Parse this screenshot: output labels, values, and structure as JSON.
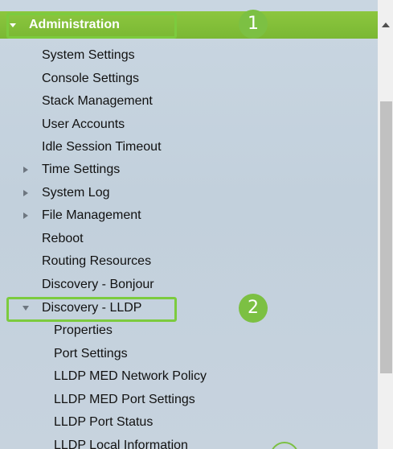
{
  "header": {
    "label": "Administration",
    "annotation_number": "1"
  },
  "menu": {
    "items": [
      {
        "label": "System Settings"
      },
      {
        "label": "Console Settings"
      },
      {
        "label": "Stack Management"
      },
      {
        "label": "User Accounts"
      },
      {
        "label": "Idle Session Timeout"
      },
      {
        "label": "Time Settings",
        "expandable": true,
        "expanded": false
      },
      {
        "label": "System Log",
        "expandable": true,
        "expanded": false
      },
      {
        "label": "File Management",
        "expandable": true,
        "expanded": false
      },
      {
        "label": "Reboot"
      },
      {
        "label": "Routing Resources"
      },
      {
        "label": "Discovery - Bonjour"
      },
      {
        "label": "Discovery - LLDP",
        "expandable": true,
        "expanded": true
      }
    ],
    "lldp_annotation_number": "2",
    "lldp_subitems": [
      {
        "label": "Properties"
      },
      {
        "label": "Port Settings"
      },
      {
        "label": "LLDP MED Network Policy"
      },
      {
        "label": "LLDP MED Port Settings"
      },
      {
        "label": "LLDP Port Status"
      },
      {
        "label": "LLDP Local Information"
      }
    ]
  },
  "colors": {
    "header_green": "#8cc63f",
    "highlight_green": "#7ccb3e",
    "badge_green": "#7cc043",
    "panel_bg": "#c6d3de",
    "text": "#111111"
  },
  "icons": {
    "expanded_arrow": "chevron-down-icon",
    "collapsed_arrow": "chevron-right-icon",
    "scroll_up": "scroll-up-icon"
  }
}
